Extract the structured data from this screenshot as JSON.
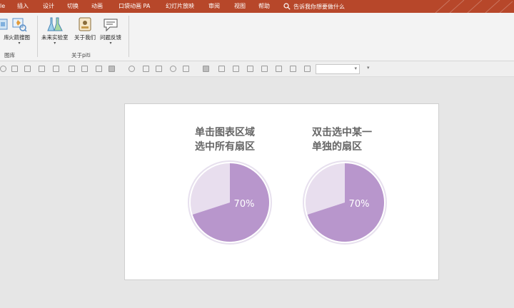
{
  "menu": {
    "tabs": [
      "le",
      "插入",
      "设计",
      "切换",
      "动画",
      "口袋动画 PA",
      "幻灯片放映",
      "审阅",
      "视图",
      "帮助"
    ],
    "tellme": "告诉我你想要做什么"
  },
  "ribbon": {
    "buttons": [
      "库",
      "火箭搜图",
      "未来实验室",
      "关于我们",
      "问题反馈"
    ],
    "groups": [
      "图库",
      "关于piti"
    ]
  },
  "slide": {
    "caption_left": [
      "单击图表区域",
      "选中所有扇区"
    ],
    "caption_right": [
      "双击选中某一",
      "单独的扇区"
    ],
    "pie_left_label": "70%",
    "pie_right_label": "70%"
  },
  "colors": {
    "accent": "#b7472a",
    "pie_main": "#b896cc",
    "pie_rest": "#e8deee",
    "pie_ring": "#e7e0ee"
  },
  "chart_data": [
    {
      "type": "pie",
      "categories": [
        "70%",
        ""
      ],
      "values": [
        70,
        30
      ],
      "title": "",
      "colors": [
        "#b896cc",
        "#e8deee"
      ]
    },
    {
      "type": "pie",
      "categories": [
        "70%",
        ""
      ],
      "values": [
        70,
        30
      ],
      "title": "",
      "colors": [
        "#b896cc",
        "#e8deee"
      ]
    }
  ]
}
